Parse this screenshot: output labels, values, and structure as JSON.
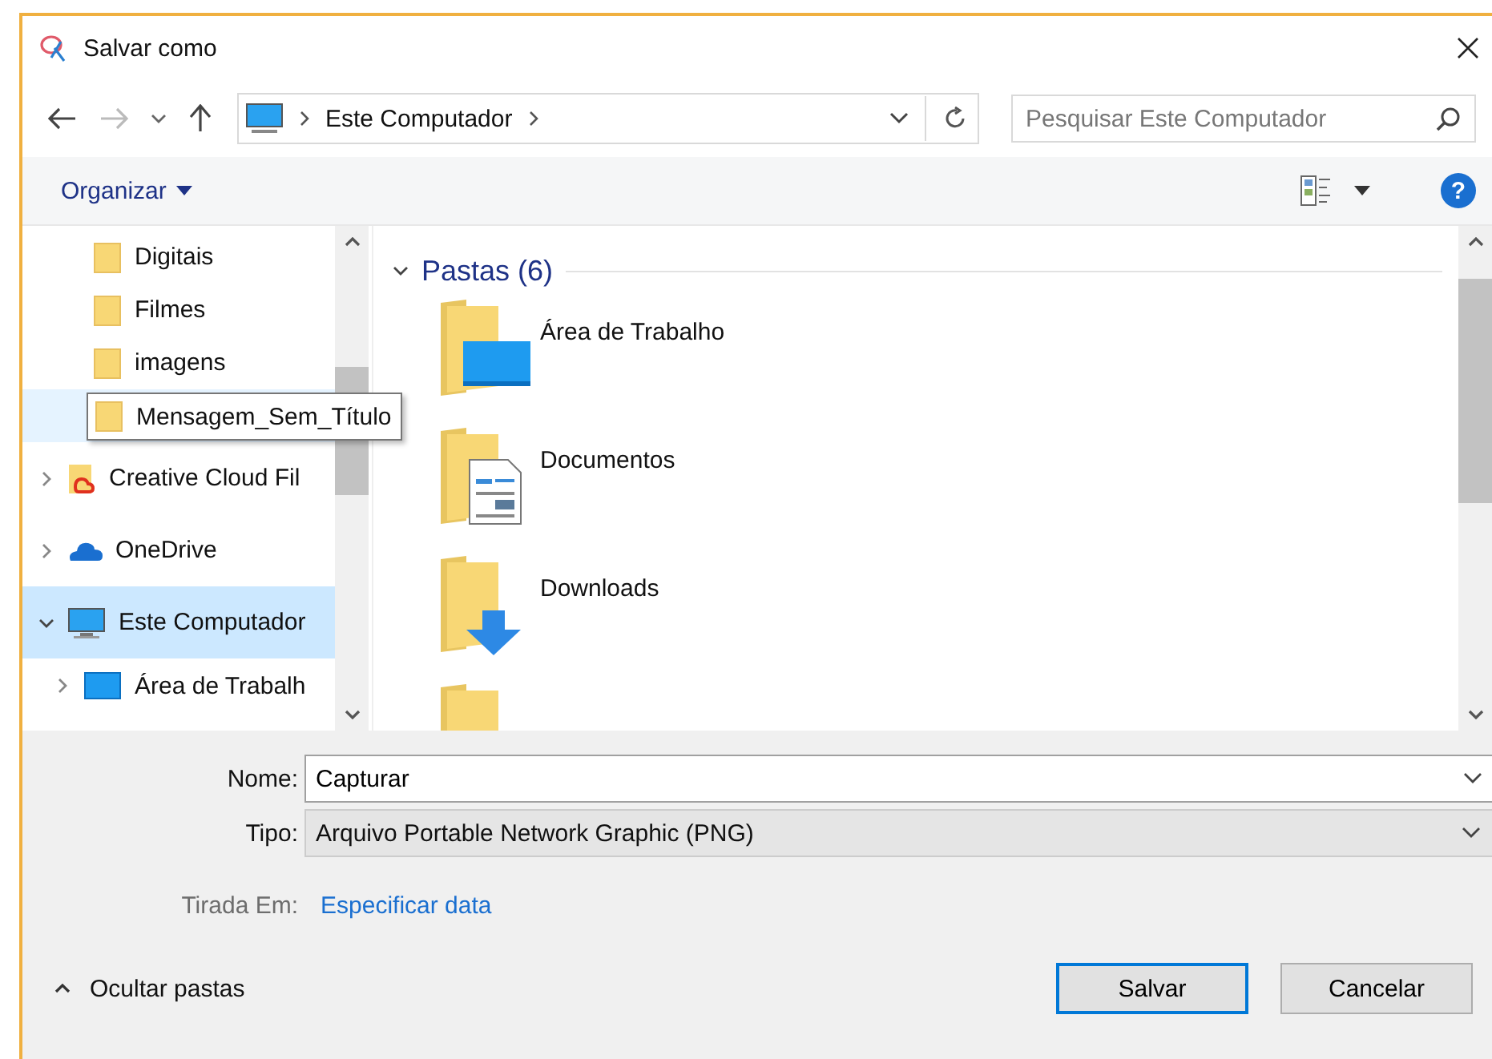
{
  "window": {
    "title": "Salvar como"
  },
  "address": {
    "location": "Este Computador",
    "search_placeholder": "Pesquisar Este Computador"
  },
  "toolbar": {
    "organize": "Organizar",
    "help": "?"
  },
  "nav": {
    "partial_children": [
      {
        "label": "Digitais",
        "hovered": false
      },
      {
        "label": "Filmes",
        "hovered": false
      },
      {
        "label": "imagens",
        "hovered": false
      },
      {
        "label": "Mensagem_Sem_Título",
        "hovered": true
      }
    ],
    "items": [
      {
        "label": "Creative Cloud Fil",
        "kind": "creative",
        "expanded": false,
        "selected": false
      },
      {
        "label": "OneDrive",
        "kind": "cloud",
        "expanded": false,
        "selected": false
      },
      {
        "label": "Este Computador",
        "kind": "computer",
        "expanded": true,
        "selected": true,
        "children": [
          {
            "label": "Área de Trabalh",
            "kind": "desktop",
            "expanded": false,
            "selected": false
          }
        ]
      }
    ]
  },
  "content": {
    "group": {
      "label": "Pastas (6)",
      "expanded": true
    },
    "folders": [
      {
        "label": "Área de Trabalho",
        "kind": "desktop"
      },
      {
        "label": "Documentos",
        "kind": "document"
      },
      {
        "label": "Downloads",
        "kind": "download"
      },
      {
        "kind": "plain"
      }
    ]
  },
  "form": {
    "name_label": "Nome:",
    "name_value": "Capturar",
    "type_label": "Tipo:",
    "type_value": "Arquivo Portable Network Graphic (PNG)",
    "date_label": "Tirada Em:",
    "date_link": "Especificar data"
  },
  "footer": {
    "toggle": "Ocultar pastas",
    "buttons": [
      {
        "label": "Salvar",
        "default": true
      },
      {
        "label": "Cancelar",
        "default": false
      }
    ]
  }
}
